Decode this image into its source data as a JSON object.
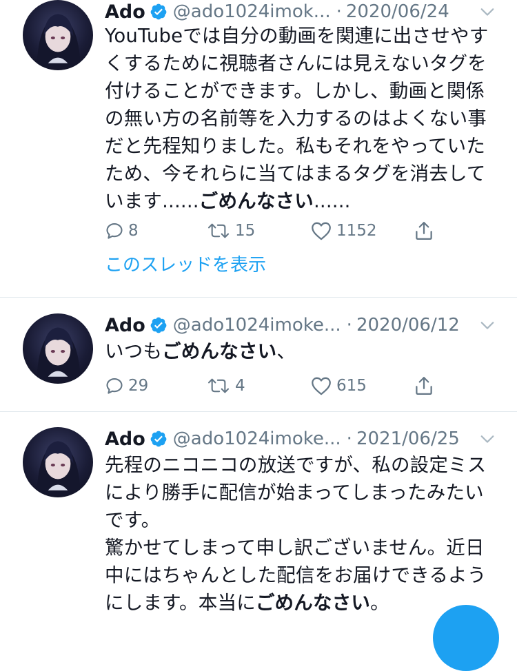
{
  "tweets": [
    {
      "name": "Ado",
      "handle": "@ado1024imok...",
      "dot": "·",
      "date": "2020/06/24",
      "text_parts": [
        "YouTubeでは自分の動画を関連に出させやすくするために視聴者さんには見えないタグを付けることができます。しかし、動画と関係の無い方の名前等を入力するのはよくない事だと先程知りました。私もそれをやっていたため、今それらに当てはまるタグを消去しています......",
        "ごめんなさい",
        "......"
      ],
      "replies": "8",
      "retweets": "15",
      "likes": "1152",
      "thread_link": "このスレッドを表示"
    },
    {
      "name": "Ado",
      "handle": "@ado1024imoke...",
      "dot": "·",
      "date": "2020/06/12",
      "text_parts": [
        "いつも",
        "ごめんなさい",
        "、"
      ],
      "replies": "29",
      "retweets": "4",
      "likes": "615"
    },
    {
      "name": "Ado",
      "handle": "@ado1024imoke...",
      "dot": "·",
      "date": "2021/06/25",
      "text_parts": [
        "先程のニコニコの放送ですが、私の設定ミスにより勝手に配信が始まってしまったみたいです。",
        "驚かせてしまって申し訳ございません。近日中にはちゃんとした配信をお届けできるようにします。本当に",
        "ごめんなさい",
        "。"
      ]
    }
  ],
  "icons": {
    "verified": "verified-badge-icon",
    "chevron": "chevron-down-icon",
    "reply": "reply-icon",
    "retweet": "retweet-icon",
    "like": "heart-icon",
    "share": "share-icon",
    "compose": "compose-fab"
  },
  "colors": {
    "accent": "#1da1f2",
    "muted": "#657786",
    "text": "#141823",
    "divider": "#e1e8ed"
  }
}
